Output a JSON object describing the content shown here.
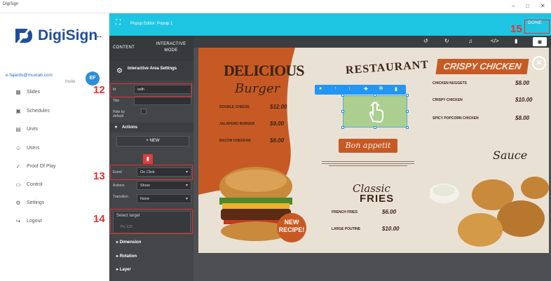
{
  "window": {
    "title": "DigiSign",
    "minimize": "–",
    "maximize": "□",
    "close": "✕"
  },
  "sidebar": {
    "logo_text": "DigiSign",
    "user_email": "e.fajardo@muxlab.com",
    "user_role": "Invite",
    "avatar_initials": "EF",
    "items": [
      {
        "label": "Slides",
        "icon": "grid-icon"
      },
      {
        "label": "Schedules",
        "icon": "calendar-icon"
      },
      {
        "label": "Units",
        "icon": "units-icon"
      },
      {
        "label": "Users",
        "icon": "user-icon"
      },
      {
        "label": "Proof Of Play",
        "icon": "check-icon"
      },
      {
        "label": "Control",
        "icon": "monitor-icon"
      },
      {
        "label": "Settings",
        "icon": "gear-icon"
      },
      {
        "label": "Logout",
        "icon": "logout-icon"
      }
    ]
  },
  "editor": {
    "title": "Popup Editor: Popup 1",
    "done_label": "DONE"
  },
  "panel": {
    "tab_content": "CONTENT",
    "tab_interactive": "INTERACTIVE MODE",
    "area_settings_title": "Interactive Area Settings",
    "fields": {
      "id_label": "Id",
      "id_value": "wdh",
      "title_label": "Title",
      "hide_label": "Hide by default"
    },
    "actions_heading": "Actions",
    "new_button": "+ NEW",
    "event_label": "Event",
    "event_value": "On Click",
    "action_label": "Actions",
    "action_value": "Show",
    "transition_label": "Transition",
    "transition_value": "None",
    "select_target_label": "Select target",
    "select_target_placeholder": "Pic 123",
    "dimension": "Dimension",
    "rotation": "Rotation",
    "layer": "Layer"
  },
  "annotations": {
    "n12": "12",
    "n13": "13",
    "n14": "14",
    "n15": "15"
  },
  "menu": {
    "delicious": "DELICIOUS",
    "burger": "Burger",
    "restaurant": "RESTAURANT",
    "bon_appetit": "Bon appetit",
    "classic": "Classic",
    "fries": "FRIES",
    "crispy_chicken": "CRISPY CHICKEN",
    "sauce": "Sauce",
    "new_recipe": "NEW RECIPE!",
    "left_items": [
      {
        "name": "DOUBLE CHEESE",
        "price": "$12.00"
      },
      {
        "name": "JALAPENO BURGER",
        "price": "$9.00"
      },
      {
        "name": "BACON CHEDDAR",
        "price": "$8.00"
      }
    ],
    "fries_items": [
      {
        "name": "FRENCH FRIES",
        "price": "$6.00"
      },
      {
        "name": "LARGE POUTINE",
        "price": "$10.00"
      }
    ],
    "chicken_items": [
      {
        "name": "CHICKEN NUGGETS",
        "price": "$8.00"
      },
      {
        "name": "CRISPY CHICKEN",
        "price": "$10.00"
      },
      {
        "name": "SPICY POPCORN CHICKEN",
        "price": "$8.00"
      }
    ]
  },
  "colors": {
    "header": "#1ec5e2",
    "panel": "#434548",
    "annotation": "#e53030",
    "accent_orange": "#c75a24",
    "selection_toolbar": "#2196f3"
  }
}
